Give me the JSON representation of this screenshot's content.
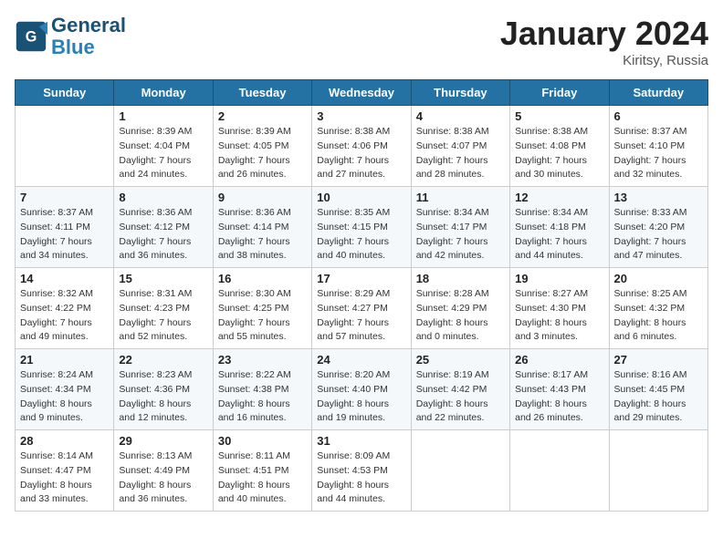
{
  "header": {
    "logo_line1": "General",
    "logo_line2": "Blue",
    "month": "January 2024",
    "location": "Kiritsy, Russia"
  },
  "days_of_week": [
    "Sunday",
    "Monday",
    "Tuesday",
    "Wednesday",
    "Thursday",
    "Friday",
    "Saturday"
  ],
  "weeks": [
    [
      {
        "num": "",
        "info": ""
      },
      {
        "num": "1",
        "info": "Sunrise: 8:39 AM\nSunset: 4:04 PM\nDaylight: 7 hours\nand 24 minutes."
      },
      {
        "num": "2",
        "info": "Sunrise: 8:39 AM\nSunset: 4:05 PM\nDaylight: 7 hours\nand 26 minutes."
      },
      {
        "num": "3",
        "info": "Sunrise: 8:38 AM\nSunset: 4:06 PM\nDaylight: 7 hours\nand 27 minutes."
      },
      {
        "num": "4",
        "info": "Sunrise: 8:38 AM\nSunset: 4:07 PM\nDaylight: 7 hours\nand 28 minutes."
      },
      {
        "num": "5",
        "info": "Sunrise: 8:38 AM\nSunset: 4:08 PM\nDaylight: 7 hours\nand 30 minutes."
      },
      {
        "num": "6",
        "info": "Sunrise: 8:37 AM\nSunset: 4:10 PM\nDaylight: 7 hours\nand 32 minutes."
      }
    ],
    [
      {
        "num": "7",
        "info": "Sunrise: 8:37 AM\nSunset: 4:11 PM\nDaylight: 7 hours\nand 34 minutes."
      },
      {
        "num": "8",
        "info": "Sunrise: 8:36 AM\nSunset: 4:12 PM\nDaylight: 7 hours\nand 36 minutes."
      },
      {
        "num": "9",
        "info": "Sunrise: 8:36 AM\nSunset: 4:14 PM\nDaylight: 7 hours\nand 38 minutes."
      },
      {
        "num": "10",
        "info": "Sunrise: 8:35 AM\nSunset: 4:15 PM\nDaylight: 7 hours\nand 40 minutes."
      },
      {
        "num": "11",
        "info": "Sunrise: 8:34 AM\nSunset: 4:17 PM\nDaylight: 7 hours\nand 42 minutes."
      },
      {
        "num": "12",
        "info": "Sunrise: 8:34 AM\nSunset: 4:18 PM\nDaylight: 7 hours\nand 44 minutes."
      },
      {
        "num": "13",
        "info": "Sunrise: 8:33 AM\nSunset: 4:20 PM\nDaylight: 7 hours\nand 47 minutes."
      }
    ],
    [
      {
        "num": "14",
        "info": "Sunrise: 8:32 AM\nSunset: 4:22 PM\nDaylight: 7 hours\nand 49 minutes."
      },
      {
        "num": "15",
        "info": "Sunrise: 8:31 AM\nSunset: 4:23 PM\nDaylight: 7 hours\nand 52 minutes."
      },
      {
        "num": "16",
        "info": "Sunrise: 8:30 AM\nSunset: 4:25 PM\nDaylight: 7 hours\nand 55 minutes."
      },
      {
        "num": "17",
        "info": "Sunrise: 8:29 AM\nSunset: 4:27 PM\nDaylight: 7 hours\nand 57 minutes."
      },
      {
        "num": "18",
        "info": "Sunrise: 8:28 AM\nSunset: 4:29 PM\nDaylight: 8 hours\nand 0 minutes."
      },
      {
        "num": "19",
        "info": "Sunrise: 8:27 AM\nSunset: 4:30 PM\nDaylight: 8 hours\nand 3 minutes."
      },
      {
        "num": "20",
        "info": "Sunrise: 8:25 AM\nSunset: 4:32 PM\nDaylight: 8 hours\nand 6 minutes."
      }
    ],
    [
      {
        "num": "21",
        "info": "Sunrise: 8:24 AM\nSunset: 4:34 PM\nDaylight: 8 hours\nand 9 minutes."
      },
      {
        "num": "22",
        "info": "Sunrise: 8:23 AM\nSunset: 4:36 PM\nDaylight: 8 hours\nand 12 minutes."
      },
      {
        "num": "23",
        "info": "Sunrise: 8:22 AM\nSunset: 4:38 PM\nDaylight: 8 hours\nand 16 minutes."
      },
      {
        "num": "24",
        "info": "Sunrise: 8:20 AM\nSunset: 4:40 PM\nDaylight: 8 hours\nand 19 minutes."
      },
      {
        "num": "25",
        "info": "Sunrise: 8:19 AM\nSunset: 4:42 PM\nDaylight: 8 hours\nand 22 minutes."
      },
      {
        "num": "26",
        "info": "Sunrise: 8:17 AM\nSunset: 4:43 PM\nDaylight: 8 hours\nand 26 minutes."
      },
      {
        "num": "27",
        "info": "Sunrise: 8:16 AM\nSunset: 4:45 PM\nDaylight: 8 hours\nand 29 minutes."
      }
    ],
    [
      {
        "num": "28",
        "info": "Sunrise: 8:14 AM\nSunset: 4:47 PM\nDaylight: 8 hours\nand 33 minutes."
      },
      {
        "num": "29",
        "info": "Sunrise: 8:13 AM\nSunset: 4:49 PM\nDaylight: 8 hours\nand 36 minutes."
      },
      {
        "num": "30",
        "info": "Sunrise: 8:11 AM\nSunset: 4:51 PM\nDaylight: 8 hours\nand 40 minutes."
      },
      {
        "num": "31",
        "info": "Sunrise: 8:09 AM\nSunset: 4:53 PM\nDaylight: 8 hours\nand 44 minutes."
      },
      {
        "num": "",
        "info": ""
      },
      {
        "num": "",
        "info": ""
      },
      {
        "num": "",
        "info": ""
      }
    ]
  ]
}
